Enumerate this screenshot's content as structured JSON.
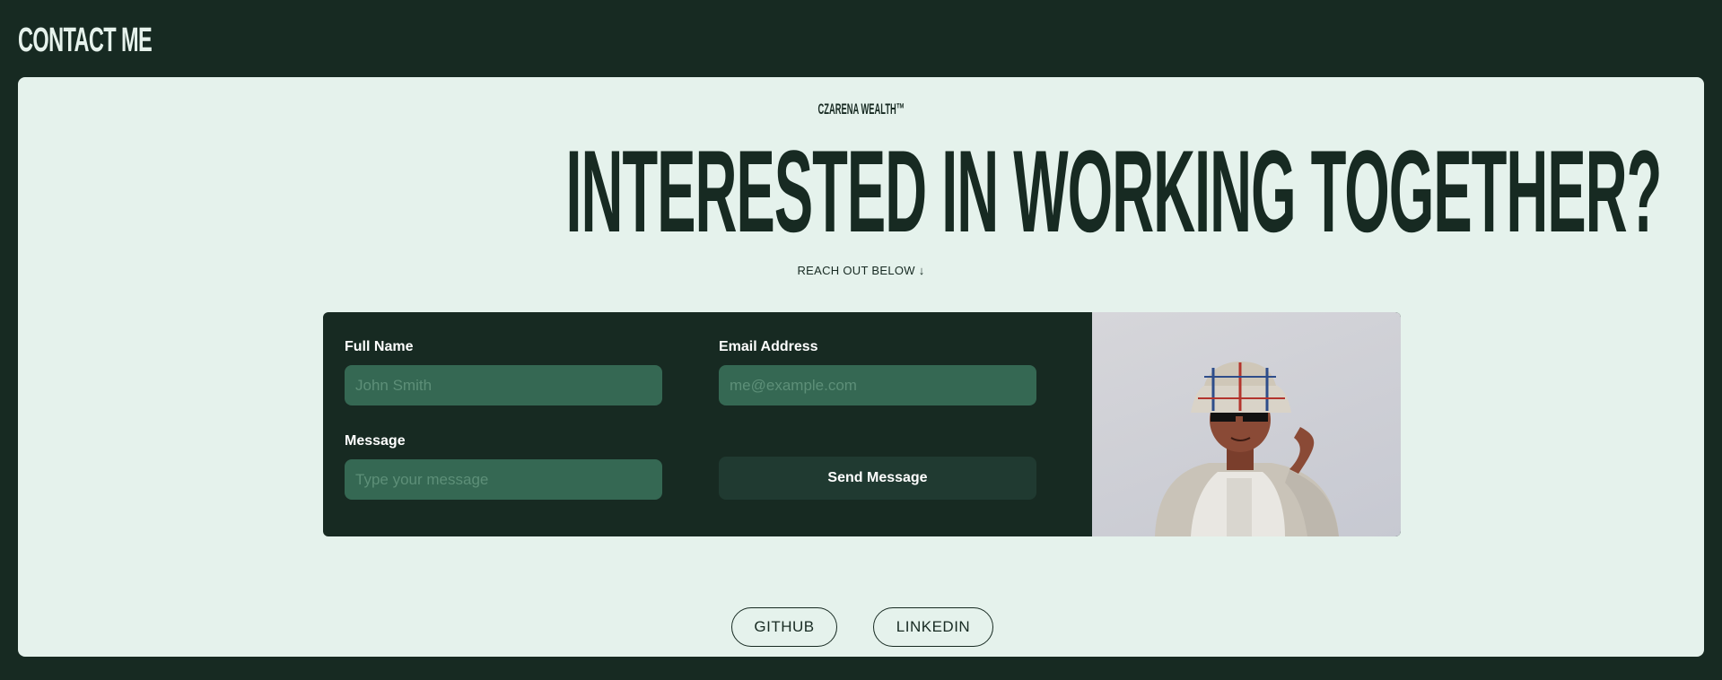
{
  "header": {
    "title": "CONTACT ME"
  },
  "hero": {
    "brand": "CZARENA WEALTH™",
    "headline": "INTERESTED IN WORKING TOGETHER?",
    "subline": "REACH OUT BELOW ↓"
  },
  "form": {
    "full_name": {
      "label": "Full Name",
      "placeholder": "John Smith",
      "value": ""
    },
    "email": {
      "label": "Email Address",
      "placeholder": "me@example.com",
      "value": ""
    },
    "message": {
      "label": "Message",
      "placeholder": "Type your message",
      "value": ""
    },
    "send_label": "Send Message"
  },
  "social": {
    "github": "GITHUB",
    "linkedin": "LINKEDIN"
  },
  "colors": {
    "background": "#172a22",
    "card": "#e5f2ec",
    "input": "#356853",
    "button": "#203a31"
  }
}
